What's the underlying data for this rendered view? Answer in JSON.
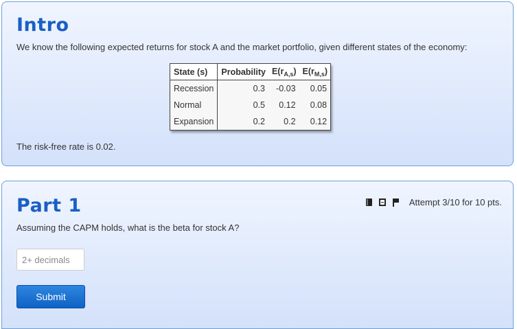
{
  "intro": {
    "heading": "Intro",
    "description": "We know the following expected returns for stock A and the market portfolio, given different states of the economy:",
    "table": {
      "headers": {
        "state": "State (s)",
        "probability": "Probability",
        "ra_prefix": "E(r",
        "ra_sub": "A,s",
        "ra_suffix": ")",
        "rm_prefix": "E(r",
        "rm_sub": "M,s",
        "rm_suffix": ")"
      },
      "rows": [
        {
          "state": "Recession",
          "probability": "0.3",
          "ra": "-0.03",
          "rm": "0.05"
        },
        {
          "state": "Normal",
          "probability": "0.5",
          "ra": "0.12",
          "rm": "0.08"
        },
        {
          "state": "Expansion",
          "probability": "0.2",
          "ra": "0.2",
          "rm": "0.12"
        }
      ]
    },
    "risk_free_text": "The risk-free rate is 0.02."
  },
  "part1": {
    "heading": "Part 1",
    "question": "Assuming the CAPM holds, what is the beta for stock A?",
    "answer_value": "",
    "answer_placeholder": "2+ decimals",
    "submit_label": "Submit",
    "toolbar": {
      "icons": [
        "book-icon",
        "film-icon",
        "flag-icon"
      ],
      "attempt_text": "Attempt 3/10 for 10 pts."
    }
  },
  "colors": {
    "heading": "#1a5fc4",
    "panel_border": "#6d9fd6",
    "panel_top": "#f0f5ff",
    "panel_bottom": "#d3e1fa",
    "button": "#0f62c4"
  }
}
